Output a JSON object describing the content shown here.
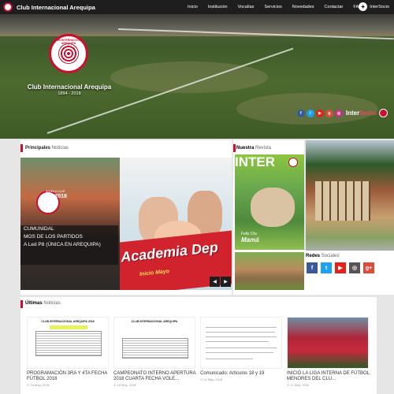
{
  "header": {
    "brand": "Club Internacional Arequipa",
    "nav": [
      "Inicio",
      "Institución",
      "Vocalías",
      "Servicios",
      "Novedades",
      "Contactar",
      "FAQ"
    ],
    "intersocio": "InterSocio"
  },
  "hero": {
    "club_name": "Club Internacional Arequipa",
    "years": "1894 - 2018",
    "crest_text": "CLUB INTERNACIONAL AREQUIPA",
    "intersocio_a": "Inter",
    "intersocio_b": "Socio"
  },
  "principales": {
    "title_bold": "Principales",
    "title_light": "Noticias",
    "slide_dark_lines": [
      "WORLD CUP",
      "SIA 2018",
      "CUMUNIDAL",
      "MOS DE LOS PARTIDOS",
      "A Led P8 (ÚNICA EN AREQUIPA)"
    ],
    "slide_academia": "Academia Dep",
    "slide_inicio": "Inicio Mayo",
    "prev": "◀",
    "next": "▶"
  },
  "revista": {
    "title_bold": "Nuestra",
    "title_light": "Revista",
    "cover_word": "INTER",
    "feliz": "Feliz Día",
    "mama": "Mamá"
  },
  "redes": {
    "title_bold": "Redes",
    "title_light": "Sociales",
    "icons": [
      "f",
      "t",
      "▶",
      "◎",
      "g+"
    ]
  },
  "ultimas": {
    "title_bold": "Últimas",
    "title_light": "Noticias",
    "items": [
      {
        "title": "PROGRAMACIÓN 3RA Y 4TA FECHA FÚTBOL 2018",
        "date": "18 May, 2018",
        "doc_head": "CLUB INTERNACIONAL AREQUIPA 2018"
      },
      {
        "title": "CAMPEONATO INTERNO APERTURA 2018 CUARTA FECHA VOLE...",
        "date": "18 May, 2018",
        "doc_head": "CLUB INTERNACIONAL AREQUIPA"
      },
      {
        "title": "Comunicado: Artículos 18 y 19",
        "date": "11 May, 2018",
        "doc_head": ""
      },
      {
        "title": "INICIÓ LA LIGA INTERNA DE FÚTBOL MENORES DEL CLU...",
        "date": "11 May, 2018",
        "doc_head": ""
      }
    ]
  },
  "colors": {
    "topbar": "#1e1e1e",
    "accent": "#c8102e",
    "facebook": "#3b5998",
    "twitter": "#1da1f2",
    "youtube": "#e62117",
    "instagram": "#c13584",
    "googleplus": "#dd4b39"
  }
}
